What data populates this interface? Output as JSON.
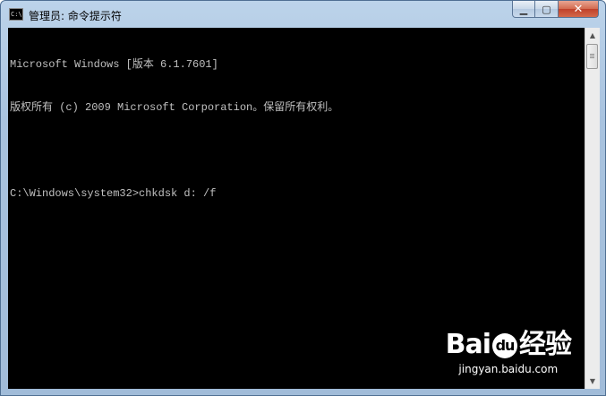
{
  "window": {
    "title": "管理员: 命令提示符",
    "icon_text": "C:\\",
    "buttons": {
      "minimize_icon": "minimize-icon",
      "maximize_icon": "maximize-icon",
      "close_icon": "close-icon"
    }
  },
  "console": {
    "lines": [
      "Microsoft Windows [版本 6.1.7601]",
      "版权所有 (c) 2009 Microsoft Corporation。保留所有权利。",
      "",
      "C:\\Windows\\system32>chkdsk d: /f"
    ]
  },
  "watermark": {
    "brand_left": "Bai",
    "brand_paw": "du",
    "brand_right": "经验",
    "url": "jingyan.baidu.com"
  },
  "colors": {
    "console_bg": "#000000",
    "console_text": "#c0c0c0",
    "close_button": "#c7472f"
  }
}
